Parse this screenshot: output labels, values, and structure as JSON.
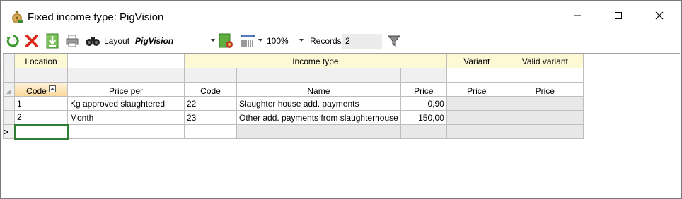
{
  "window": {
    "title": "Fixed income type: PigVision"
  },
  "toolbar": {
    "layout_label": "Layout",
    "layout_value": "PigVision",
    "zoom_value": "100%",
    "records_label": "Records",
    "records_count": "2",
    "icons": [
      "refresh-icon",
      "delete-icon",
      "import-icon",
      "print-icon",
      "binoculars-icon",
      "layout-settings-icon",
      "column-width-icon",
      "filter-icon"
    ]
  },
  "grid": {
    "bands": {
      "location": "Location",
      "income_type": "Income type",
      "variant": "Variant",
      "valid_variant": "Valid variant"
    },
    "headers": {
      "code": "Code",
      "price_per": "Price per",
      "income_code": "Code",
      "name": "Name",
      "price": "Price",
      "variant_price": "Price",
      "valid_variant_price": "Price"
    },
    "rows": [
      {
        "code": "1",
        "price_per": "Kg approved slaughtered",
        "income_code": "22",
        "name": "Slaughter house add. payments",
        "price": "0,90",
        "variant_price": "",
        "valid_variant_price": ""
      },
      {
        "code": "2",
        "price_per": "Month",
        "income_code": "23",
        "name": "Other add. payments from slaughterhouse",
        "price": "150,00",
        "variant_price": "",
        "valid_variant_price": ""
      }
    ],
    "new_row_pointer": ">"
  },
  "colors": {
    "band_yellow": "#fdf9d5",
    "sorted_header": "#fad79a",
    "edit_border": "#2e7d32"
  }
}
